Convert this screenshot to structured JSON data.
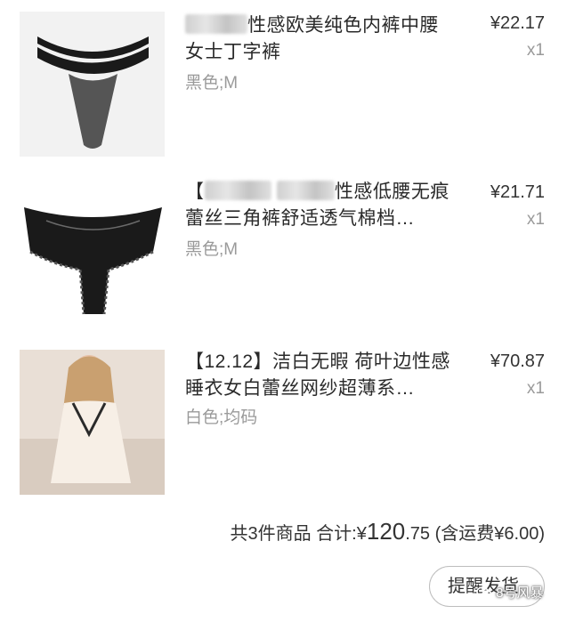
{
  "items": [
    {
      "title_prefix": "",
      "title": "性感欧美纯色内裤中腰女士丁字裤",
      "spec": "黑色;M",
      "price": "¥22.17",
      "qty": "x1",
      "image_icon": "black-thong-product-image"
    },
    {
      "title_prefix": "【",
      "title": "性感低腰无痕蕾丝三角裤舒适透气棉档…",
      "spec": "黑色;M",
      "price": "¥21.71",
      "qty": "x1",
      "image_icon": "black-lace-briefs-product-image"
    },
    {
      "title_prefix": "",
      "title": "【12.12】洁白无暇 荷叶边性感睡衣女白蕾丝网纱超薄系…",
      "spec": "白色;均码",
      "price": "¥70.87",
      "qty": "x1",
      "image_icon": "white-nightgown-product-image"
    }
  ],
  "summary": {
    "count_text": "共3件商品",
    "total_label": "合计:",
    "currency": "¥",
    "total_int": "120",
    "total_dec": ".75",
    "shipping_text": "(含运费¥6.00)"
  },
  "actions": {
    "remind_label": "提醒发货"
  },
  "watermark": {
    "text": "8号风暴"
  }
}
